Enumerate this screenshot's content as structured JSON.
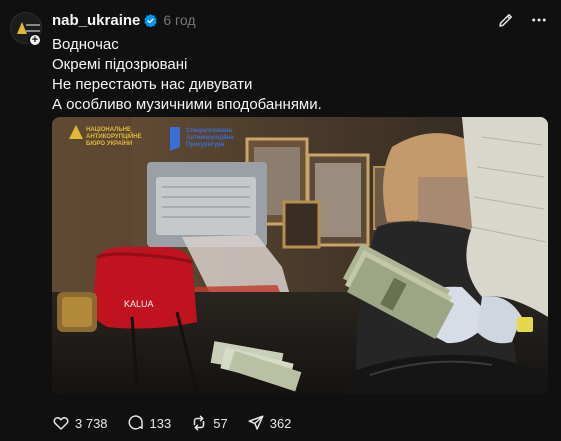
{
  "post": {
    "username": "nab_ukraine",
    "time": "6 год",
    "lines": [
      "Водночас",
      "Окремі підозрювані",
      "Не перестають нас дивувати",
      "А особливо музичними вподобаннями."
    ],
    "image": {
      "nabu_logo": [
        "НАЦІОНАЛЬНЕ",
        "АНТИКОРУПЦІЙНЕ",
        "БЮРО УКРАЇНИ"
      ],
      "sap_logo": [
        "Спеціалізована",
        "Антикорупційна",
        "Прокуратура"
      ],
      "hat_text": "KALUA"
    }
  },
  "actions": {
    "likes": "3 738",
    "comments": "133",
    "reposts": "57",
    "shares": "362"
  },
  "colors": {
    "background": "#101010",
    "verified": "#0095f6",
    "nabu_yellow": "#e2b833"
  },
  "icons": [
    "avatar",
    "verified-icon",
    "edit-icon",
    "more-icon",
    "heart-icon",
    "comment-icon",
    "repost-icon",
    "share-icon"
  ]
}
